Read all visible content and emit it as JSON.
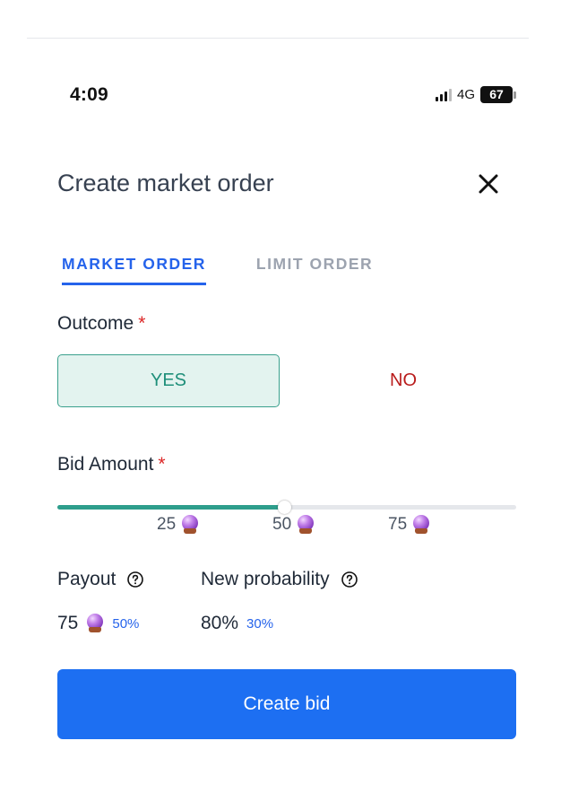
{
  "status_bar": {
    "time": "4:09",
    "network": "4G",
    "battery": "67"
  },
  "header": {
    "title": "Create market order"
  },
  "tabs": [
    {
      "label": "MARKET ORDER",
      "active": true
    },
    {
      "label": "LIMIT ORDER",
      "active": false
    }
  ],
  "outcome": {
    "label": "Outcome",
    "required_mark": "*",
    "yes_label": "YES",
    "no_label": "NO",
    "selected": "YES"
  },
  "bid": {
    "label": "Bid Amount",
    "required_mark": "*",
    "slider_value_fraction": 0.495,
    "ticks": [
      "25",
      "50",
      "75"
    ]
  },
  "payout": {
    "label": "Payout",
    "value": "75",
    "percent": "50%"
  },
  "probability": {
    "label": "New probability",
    "value": "80%",
    "change": "30%"
  },
  "submit": {
    "label": "Create bid"
  },
  "colors": {
    "accent": "#2563eb",
    "yes": "#1f8f7a",
    "no": "#b91c1c",
    "button": "#1d6ff2"
  }
}
